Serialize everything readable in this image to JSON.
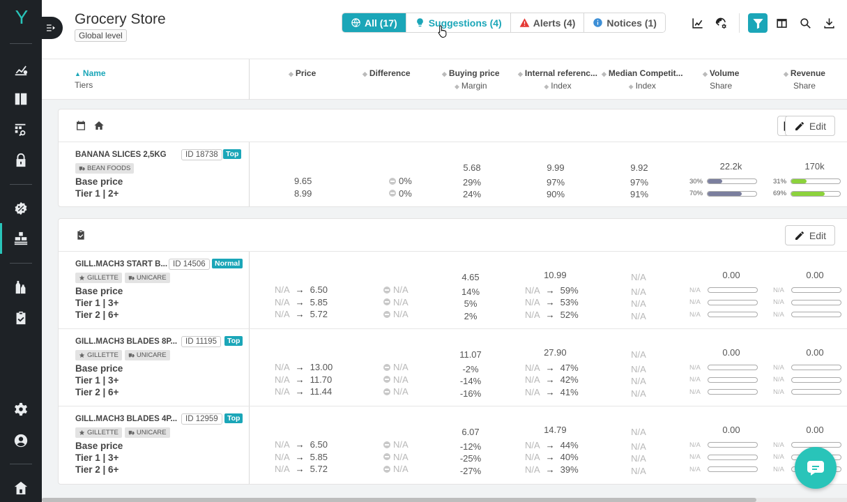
{
  "app": {
    "title": "Grocery Store",
    "level": "Global level",
    "brand_color": "#29c4b9",
    "accent_color": "#1ba6b8"
  },
  "filters": [
    {
      "label": "All (17)",
      "icon": "globe-icon",
      "active": true
    },
    {
      "label": "Suggestions (4)",
      "icon": "lightbulb-icon"
    },
    {
      "label": "Alerts (4)",
      "icon": "warning-icon"
    },
    {
      "label": "Notices (1)",
      "icon": "info-icon"
    }
  ],
  "toolbar": [
    "chart-line-icon",
    "cog-globe-icon",
    "filter-icon",
    "columns-icon",
    "search-icon",
    "download-icon"
  ],
  "columns": {
    "name": {
      "label": "Name",
      "sub": "Tiers"
    },
    "price": "Price",
    "difference": "Difference",
    "buying": {
      "label": "Buying price",
      "sub": "Margin"
    },
    "internal": {
      "label": "Internal referenc...",
      "sub": "Index"
    },
    "median": {
      "label": "Median Competit...",
      "sub": "Index"
    },
    "volume": {
      "label": "Volume",
      "sub": "Share"
    },
    "revenue": {
      "label": "Revenue",
      "sub": "Share"
    }
  },
  "edit_label": "Edit",
  "groups": [
    {
      "products": [
        {
          "name": "BANANA SLICES 2,5KG",
          "id": "ID 18738",
          "badge": "Top",
          "tags": [
            "BEAN FOODS"
          ],
          "tiers": [
            "Base price",
            "Tier 1 | 2+"
          ],
          "prices": [
            "9.65",
            "8.99"
          ],
          "diffs": [
            "0%",
            "0%"
          ],
          "buying": "5.68",
          "margins": [
            "29%",
            "24%"
          ],
          "internal": "9.99",
          "internal_idx": [
            "97%",
            "90%"
          ],
          "median": "9.92",
          "median_idx": [
            "97%",
            "91%"
          ],
          "volume": "22.2k",
          "volume_share": [
            {
              "label": "30%",
              "value": 0.3
            },
            {
              "label": "70%",
              "value": 0.7
            }
          ],
          "revenue": "170k",
          "revenue_share": [
            {
              "label": "31%",
              "value": 0.31
            },
            {
              "label": "69%",
              "value": 0.69
            }
          ]
        }
      ]
    },
    {
      "products": [
        {
          "name": "GILL.MACH3 START B...",
          "id": "ID 14506",
          "badge": "Normal",
          "tags": [
            "GILLETTE",
            "UNICARE"
          ],
          "tiers": [
            "Base price",
            "Tier 1 | 3+",
            "Tier 2 | 6+"
          ],
          "prices_from": [
            "N/A",
            "N/A",
            "N/A"
          ],
          "prices": [
            "6.50",
            "5.85",
            "5.72"
          ],
          "diffs": [
            "N/A",
            "N/A",
            "N/A"
          ],
          "buying": "4.65",
          "margins": [
            "14%",
            "5%",
            "2%"
          ],
          "internal": "10.99",
          "internal_from": [
            "N/A",
            "N/A",
            "N/A"
          ],
          "internal_idx": [
            "59%",
            "53%",
            "52%"
          ],
          "median": "N/A",
          "median_idx": [
            "N/A",
            "N/A",
            "N/A"
          ],
          "volume": "0.00",
          "volume_share": [
            {
              "label": "N/A",
              "value": 0
            },
            {
              "label": "N/A",
              "value": 0
            },
            {
              "label": "N/A",
              "value": 0
            }
          ],
          "revenue": "0.00",
          "revenue_share": [
            {
              "label": "N/A",
              "value": 0
            },
            {
              "label": "N/A",
              "value": 0
            },
            {
              "label": "N/A",
              "value": 0
            }
          ]
        },
        {
          "name": "GILL.MACH3 BLADES 8P...",
          "id": "ID 11195",
          "badge": "Top",
          "tags": [
            "GILLETTE",
            "UNICARE"
          ],
          "tiers": [
            "Base price",
            "Tier 1 | 3+",
            "Tier 2 | 6+"
          ],
          "prices_from": [
            "N/A",
            "N/A",
            "N/A"
          ],
          "prices": [
            "13.00",
            "11.70",
            "11.44"
          ],
          "diffs": [
            "N/A",
            "N/A",
            "N/A"
          ],
          "buying": "11.07",
          "margins": [
            "-2%",
            "-14%",
            "-16%"
          ],
          "internal": "27.90",
          "internal_from": [
            "N/A",
            "N/A",
            "N/A"
          ],
          "internal_idx": [
            "47%",
            "42%",
            "41%"
          ],
          "median": "N/A",
          "median_idx": [
            "N/A",
            "N/A",
            "N/A"
          ],
          "volume": "0.00",
          "volume_share": [
            {
              "label": "N/A",
              "value": 0
            },
            {
              "label": "N/A",
              "value": 0
            },
            {
              "label": "N/A",
              "value": 0
            }
          ],
          "revenue": "0.00",
          "revenue_share": [
            {
              "label": "N/A",
              "value": 0
            },
            {
              "label": "N/A",
              "value": 0
            },
            {
              "label": "N/A",
              "value": 0
            }
          ]
        },
        {
          "name": "GILL.MACH3 BLADES 4P...",
          "id": "ID 12959",
          "badge": "Top",
          "tags": [
            "GILLETTE",
            "UNICARE"
          ],
          "tiers": [
            "Base price",
            "Tier 1 | 3+",
            "Tier 2 | 6+"
          ],
          "prices_from": [
            "N/A",
            "N/A",
            "N/A"
          ],
          "prices": [
            "6.50",
            "5.85",
            "5.72"
          ],
          "diffs": [
            "N/A",
            "N/A",
            "N/A"
          ],
          "buying": "6.07",
          "margins": [
            "-12%",
            "-25%",
            "-27%"
          ],
          "internal": "14.79",
          "internal_from": [
            "N/A",
            "N/A",
            "N/A"
          ],
          "internal_idx": [
            "44%",
            "40%",
            "39%"
          ],
          "median": "N/A",
          "median_idx": [
            "N/A",
            "N/A",
            "N/A"
          ],
          "volume": "0.00",
          "volume_share": [
            {
              "label": "N/A",
              "value": 0
            },
            {
              "label": "N/A",
              "value": 0
            },
            {
              "label": "N/A",
              "value": 0
            }
          ],
          "revenue": "0.00",
          "revenue_share": [
            {
              "label": "N/A",
              "value": 0
            },
            {
              "label": "N/A",
              "value": 0
            },
            {
              "label": "N/A",
              "value": 0
            }
          ]
        }
      ]
    }
  ],
  "colors": {
    "volume_fill": "#7b7f9e",
    "revenue_fill": "#8cd23c"
  }
}
